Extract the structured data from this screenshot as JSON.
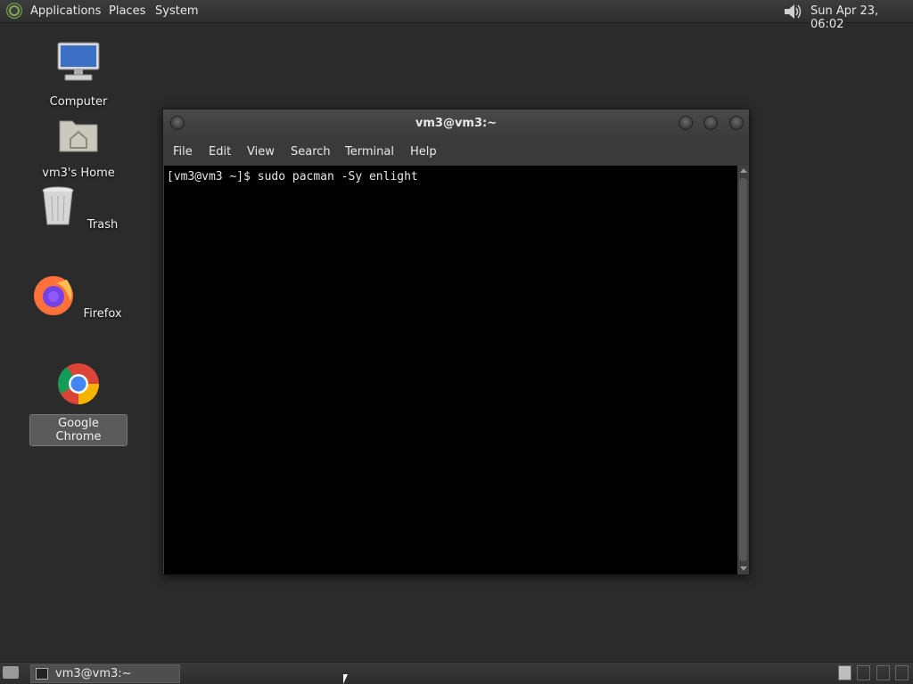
{
  "top_panel": {
    "menus": [
      "Applications",
      "Places",
      "System"
    ],
    "clock": "Sun Apr 23, 06:02",
    "icons": {
      "logo": "mate-logo-icon",
      "volume": "volume-icon"
    }
  },
  "desktop": {
    "icons": [
      {
        "label": "Computer",
        "icon": "computer-icon",
        "selected": false
      },
      {
        "label": "vm3's Home",
        "icon": "home-folder-icon",
        "selected": false
      },
      {
        "label": "Trash",
        "icon": "trash-icon",
        "selected": false
      },
      {
        "label": "Firefox",
        "icon": "firefox-icon",
        "selected": false
      },
      {
        "label": "Google Chrome",
        "icon": "chrome-icon",
        "selected": true
      }
    ]
  },
  "terminal_window": {
    "title": "vm3@vm3:~",
    "menu": [
      "File",
      "Edit",
      "View",
      "Search",
      "Terminal",
      "Help"
    ],
    "lines": [
      "[vm3@vm3 ~]$ sudo pacman -Sy enlight"
    ]
  },
  "taskbar": {
    "window_button_label": "vm3@vm3:~",
    "colors": {
      "accent": "#7fae52",
      "panel": "#333333",
      "desktop": "#2b2b2b"
    }
  }
}
